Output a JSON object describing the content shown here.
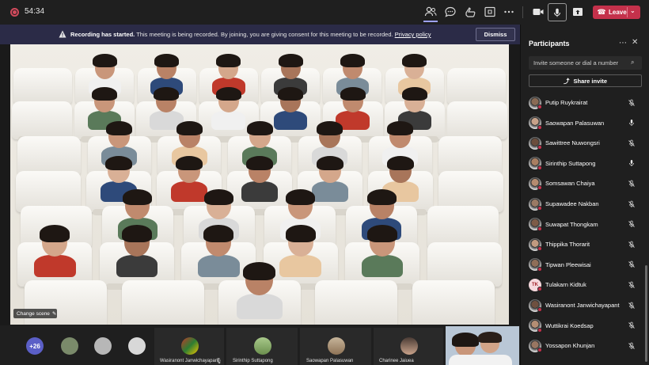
{
  "topbar": {
    "timer": "54:34",
    "leave_label": "Leave"
  },
  "banner": {
    "title": "Recording has started.",
    "message": "This meeting is being recorded. By joining, you are giving consent for this meeting to be recorded.",
    "link": "Privacy policy",
    "dismiss_label": "Dismiss"
  },
  "stage": {
    "change_scene_label": "Change scene"
  },
  "strip": {
    "more_count": "+26",
    "tiles": [
      {
        "name": "Wasiranont Janwichayapant",
        "muted": true
      },
      {
        "name": "Sirinthip Suttapong",
        "muted": false
      },
      {
        "name": "Saowapan Palasuwan",
        "muted": false
      },
      {
        "name": "Charinee Jaiuea",
        "muted": false
      }
    ]
  },
  "panel": {
    "title": "Participants",
    "invite_placeholder": "Invite someone or dial a number",
    "share_invite_label": "Share invite",
    "participants": [
      {
        "name": "Putip Ruykrairat",
        "mic": "muted",
        "avatar": "photo"
      },
      {
        "name": "Saowapan Palasuwan",
        "mic": "on",
        "avatar": "photo"
      },
      {
        "name": "Sawittree Nuwongsri",
        "mic": "muted",
        "avatar": "photo"
      },
      {
        "name": "Sirinthip Suttapong",
        "mic": "on",
        "avatar": "photo"
      },
      {
        "name": "Somsawan Chaiya",
        "mic": "muted",
        "avatar": "photo"
      },
      {
        "name": "Supawadee Nakban",
        "mic": "muted",
        "avatar": "photo"
      },
      {
        "name": "Suwapat Thongkam",
        "mic": "muted",
        "avatar": "photo"
      },
      {
        "name": "Thippika Thorarit",
        "mic": "muted",
        "avatar": "photo"
      },
      {
        "name": "Tipwan Pleewisai",
        "mic": "muted",
        "avatar": "photo"
      },
      {
        "name": "Tulakarn Kidtuk",
        "mic": "muted",
        "avatar": "initials",
        "initials": "TK"
      },
      {
        "name": "Wasiranont Janwichayapant",
        "mic": "muted",
        "avatar": "photo"
      },
      {
        "name": "Wuttikrai Koedsap",
        "mic": "muted",
        "avatar": "photo"
      },
      {
        "name": "Yossapon Khunjan",
        "mic": "muted",
        "avatar": "photo"
      }
    ]
  },
  "colors": {
    "accent": "#5b5fc7",
    "leave": "#c4314b",
    "banner": "#2b2b47"
  }
}
